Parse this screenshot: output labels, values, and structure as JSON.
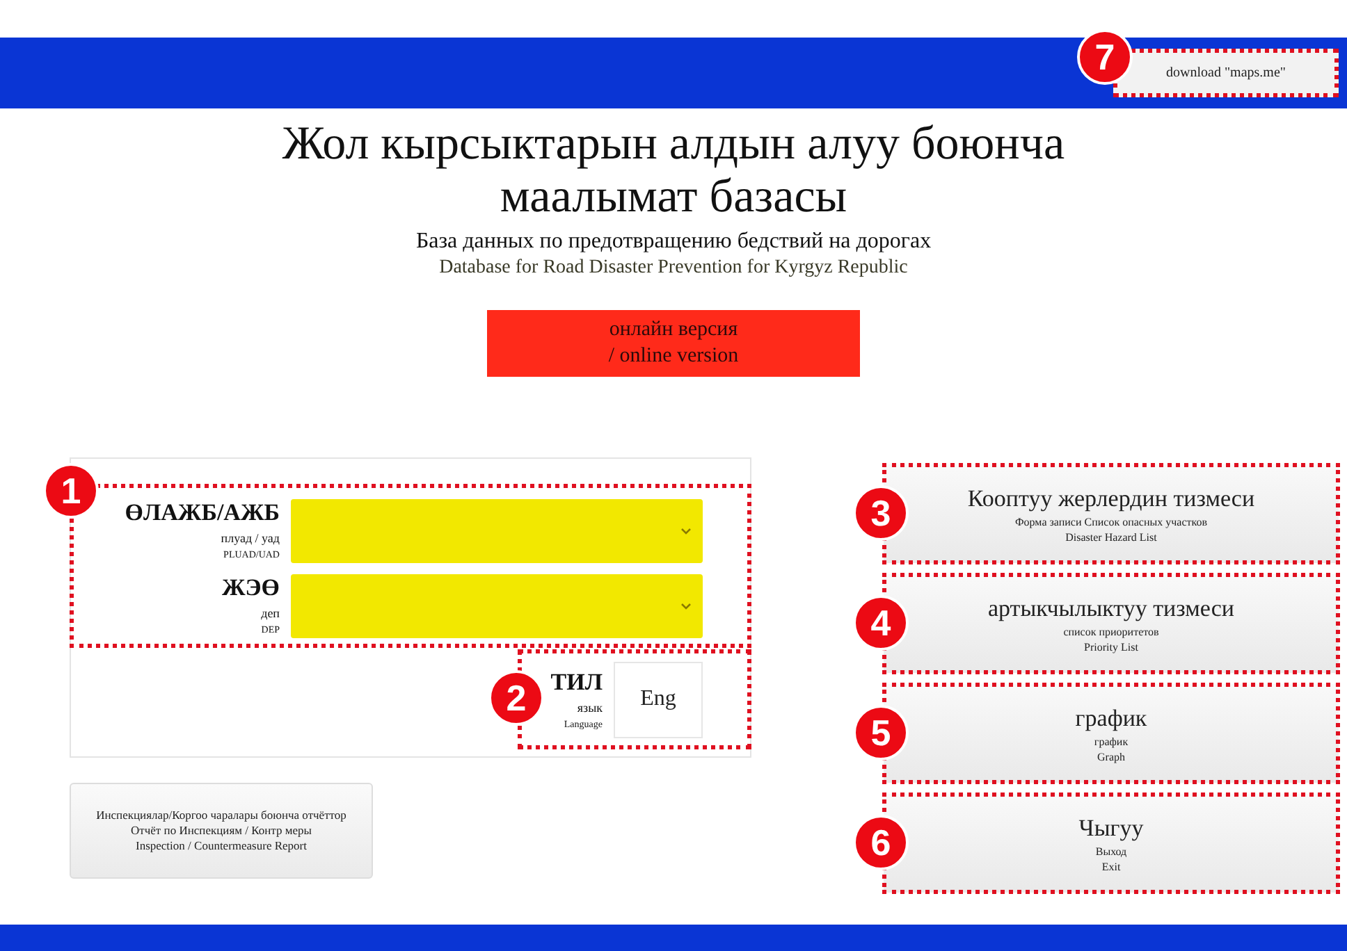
{
  "header": {
    "download_button": {
      "label": "download \"maps.me\"",
      "marker": "7"
    }
  },
  "title": "Жол кырсыктарын алдын алуу боюнча маалымат базасы",
  "subtitle_ru": "База данных по предотвращению бедствий на дорогах",
  "subtitle_en": "Database for Road Disaster Prevention for Kyrgyz Republic",
  "online_button": {
    "lines": [
      "онлайн версия",
      "/ online version"
    ]
  },
  "filter_panel": {
    "marker": "1",
    "fields": [
      {
        "label": "ӨЛАЖБ/АЖБ",
        "label_ru": "плуад / уад",
        "label_en": "PLUAD/UAD"
      },
      {
        "label": "ЖЭӨ",
        "label_ru": "деп",
        "label_en": "DEP"
      }
    ],
    "language": {
      "marker": "2",
      "label": "ТИЛ",
      "label_ru": "язык",
      "label_en": "Language",
      "button": "Eng"
    }
  },
  "report_button": {
    "lines": [
      "Инспекциялар/Коргоо чаралары боюнча отчёттор",
      "Отчёт по Инспекциям / Контр меры",
      "Inspection / Countermeasure Report"
    ]
  },
  "menu_buttons": [
    {
      "marker": "3",
      "title": "Кооптуу жерлердин тизмеси",
      "subtitle_ru": "Форма записи Список опасных участков",
      "subtitle_en": "Disaster Hazard List"
    },
    {
      "marker": "4",
      "title": "артыкчылыктуу тизмеси",
      "subtitle_ru": "список приоритетов",
      "subtitle_en": "Priority List"
    },
    {
      "marker": "5",
      "title": "график",
      "subtitle_ru": "график",
      "subtitle_en": "Graph"
    },
    {
      "marker": "6",
      "title": "Чыгуу",
      "subtitle_ru": "Выход",
      "subtitle_en": "Exit"
    }
  ]
}
